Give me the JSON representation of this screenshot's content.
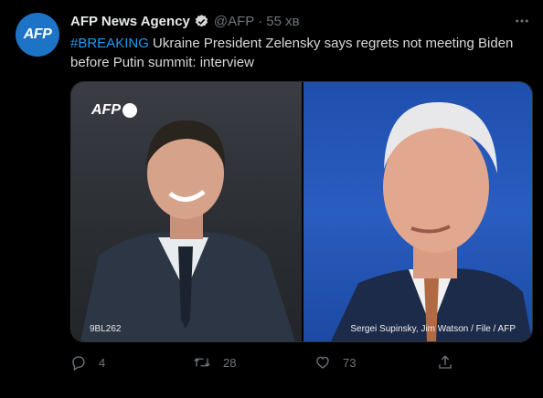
{
  "avatar": {
    "text": "AFP",
    "color": "#1d74c7"
  },
  "tweet": {
    "author_name": "AFP News Agency",
    "handle": "@AFP",
    "separator": "·",
    "time": "55 хв",
    "hashtag": "#BREAKING",
    "body": " Ukraine President Zelensky says regrets not meeting Biden before Putin summit: interview"
  },
  "media": {
    "watermark": "AFP",
    "image_code": "9BL262",
    "credit": "Sergei Supinsky, Jim Watson / File / AFP"
  },
  "actions": {
    "reply_count": "4",
    "retweet_count": "28",
    "like_count": "73"
  },
  "icons": {
    "verified": "verified-badge-icon",
    "more": "more-options-icon",
    "reply": "reply-icon",
    "retweet": "retweet-icon",
    "like": "like-icon",
    "share": "share-icon"
  },
  "colors": {
    "background": "#000000",
    "link": "#1d9bf0",
    "muted": "#6e767d"
  }
}
